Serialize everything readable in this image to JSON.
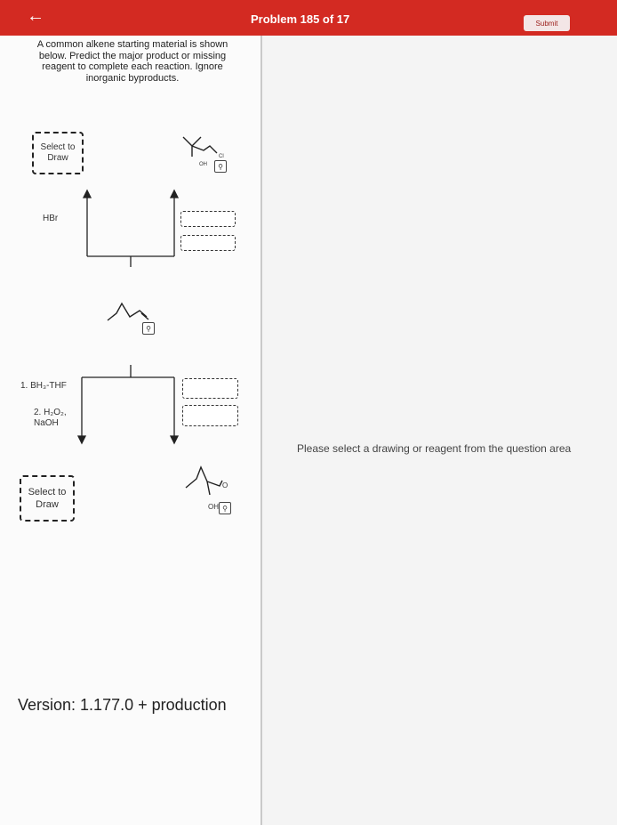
{
  "header": {
    "title": "Problem 185 of 17",
    "submit_label": "Submit",
    "back_icon": "arrow-left-icon"
  },
  "question": {
    "instructions": "A common alkene starting material is shown below. Predict the major product or missing reagent to complete each reaction. Ignore inorganic byproducts.",
    "select_draw_1": "Select to Draw",
    "select_draw_2": "Select to Draw",
    "reagent_1": "HBr",
    "reagent_2a": "1. BH₃-THF",
    "reagent_2b": "2. H₂O₂, NaOH",
    "label_cl": "Cl",
    "label_oh_1": "OH",
    "label_o": "O",
    "label_oh_2": "OH"
  },
  "footer": {
    "version": "Version: 1.177.0 + production"
  },
  "right_pane": {
    "message": "Please select a drawing or reagent from the question area"
  },
  "colors": {
    "header_bg": "#d32a22",
    "accent": "#d32a22"
  }
}
